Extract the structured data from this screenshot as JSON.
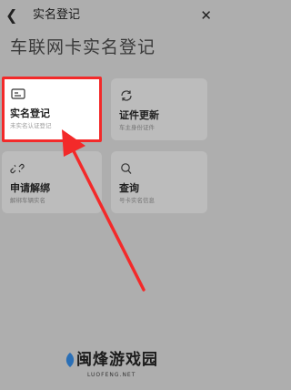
{
  "nav": {
    "back_icon": "chevron-left-icon",
    "title": "实名登记",
    "close_icon": "close-icon"
  },
  "page_title": "车联网卡实名登记",
  "cards": [
    {
      "label": "实名登记",
      "sub": "未实名认证登记",
      "icon": "id-card-icon"
    },
    {
      "label": "证件更新",
      "sub": "车主身份证件",
      "icon": "refresh-icon"
    },
    {
      "label": "申请解绑",
      "sub": "解绑车辆实名",
      "icon": "unlink-icon"
    },
    {
      "label": "查询",
      "sub": "号卡实名信息",
      "icon": "search-icon"
    }
  ],
  "annotation": {
    "highlight_color": "#f32a2a"
  },
  "watermark": {
    "text": "闽烽游戏园",
    "sub": "LUOFENG.NET"
  }
}
